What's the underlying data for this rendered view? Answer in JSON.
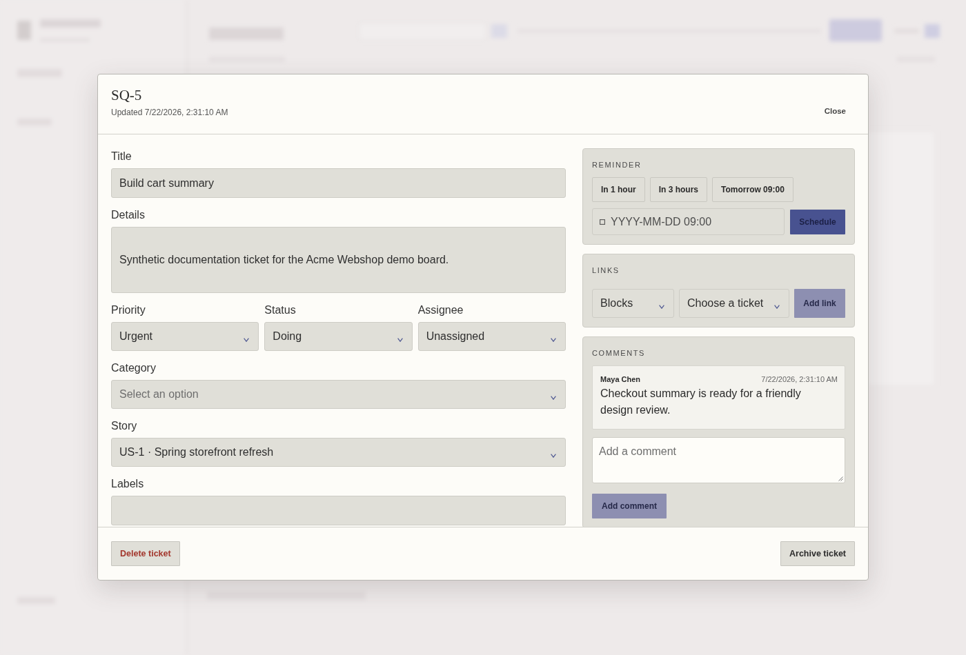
{
  "dialog": {
    "title": "SQ-5",
    "updated": "Updated 7/22/2026, 2:31:10 AM",
    "close_button": "Close"
  },
  "form": {
    "fields": [
      {
        "kind": "text",
        "label": "Title",
        "value": "Build cart summary"
      },
      {
        "kind": "textarea",
        "label": "Details",
        "value": "Synthetic documentation ticket for the Acme Webshop demo board."
      },
      {
        "kind": "select_group",
        "items": [
          {
            "label": "Priority",
            "value": "Urgent"
          },
          {
            "label": "Status",
            "value": "Doing"
          },
          {
            "label": "Assignee",
            "value": "Unassigned"
          }
        ]
      },
      {
        "kind": "select",
        "label": "Category",
        "placeholder": "Select an option"
      },
      {
        "kind": "select",
        "label": "Story",
        "value": "US-1 · Spring storefront refresh"
      },
      {
        "kind": "text",
        "label": "Labels"
      }
    ]
  },
  "reminder": {
    "heading": "REMINDER",
    "presets": [
      "In 1 hour",
      "In 3 hours",
      "Tomorrow 09:00"
    ],
    "date_field": {
      "placeholder": "YYYY-MM-DD 09:00"
    },
    "schedule_button": {
      "label": "Schedule",
      "disabled": false
    }
  },
  "links": {
    "heading": "LINKS",
    "type_select": {
      "value": "Blocks"
    },
    "ticket_select": {
      "value": "Choose a ticket"
    },
    "add_button": {
      "label": "Add link",
      "disabled": true
    }
  },
  "comments": {
    "heading": "COMMENTS",
    "items": [
      {
        "author": "Maya Chen",
        "time": "7/22/2026, 2:31:10 AM",
        "text": "Checkout summary is ready for a friendly design review."
      }
    ],
    "input": {
      "placeholder": "Add a comment"
    },
    "add_button": {
      "label": "Add comment",
      "disabled": true
    }
  },
  "footer": {
    "buttons": [
      {
        "label": "Delete ticket",
        "kind": "danger"
      },
      {
        "label": "Archive ticket",
        "kind": "default"
      }
    ]
  }
}
